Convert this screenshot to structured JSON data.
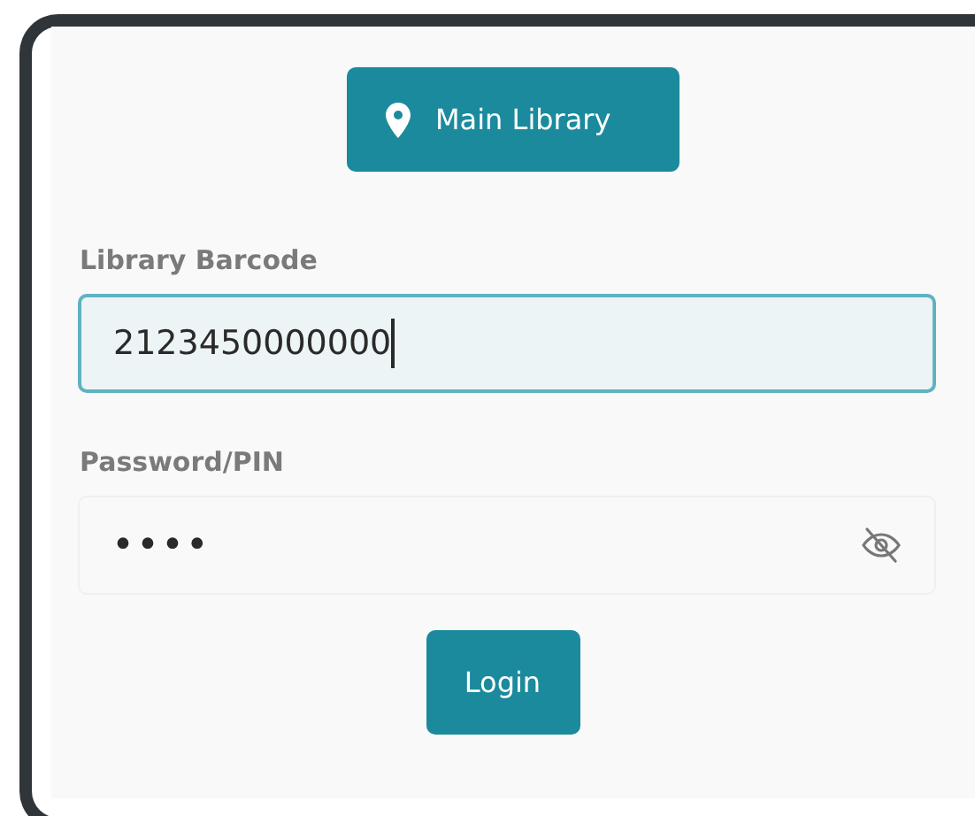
{
  "location_button": {
    "label": "Main Library"
  },
  "fields": [
    {
      "label": "Library Barcode",
      "value": "2123450000000",
      "focused": true,
      "masked": false
    },
    {
      "label": "Password/PIN",
      "value": "••••",
      "focused": false,
      "masked": true
    }
  ],
  "login_button": {
    "label": "Login"
  }
}
